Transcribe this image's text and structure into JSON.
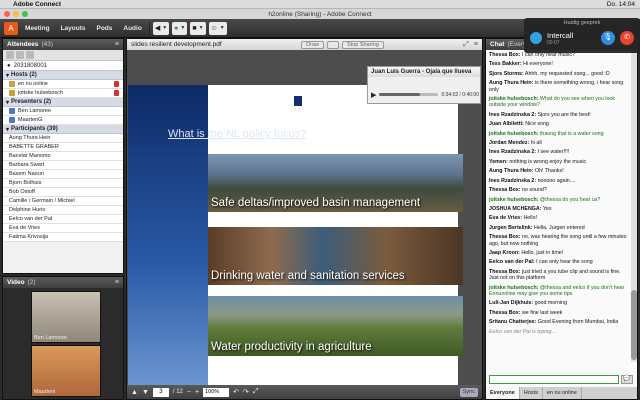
{
  "menubar": {
    "app_name": "Adobe Connect",
    "items": [
      "Meeting",
      "Layouts",
      "Pods",
      "Audio"
    ],
    "clock": "Do. 14:04"
  },
  "window": {
    "title": "h2online (Sharing) - Adobe Connect"
  },
  "toolbar": {
    "menus": [
      "Meeting",
      "Layouts",
      "Pods",
      "Audio"
    ]
  },
  "attendees": {
    "title": "Attendees",
    "count": "(43)",
    "self": "2031808001",
    "hosts": {
      "label": "Hosts (2)",
      "names": [
        "en nu online",
        "joitske hulsebosch"
      ]
    },
    "presenters": {
      "label": "Presenters (2)",
      "names": [
        "Ben Lamoree",
        "MaartenG"
      ]
    },
    "participants": {
      "label": "Participants (39)",
      "names": [
        "Aung Thura Hein",
        "BABETTE GRABER",
        "Bacelar Manomo",
        "Barbara Swart",
        "Basem Naouri",
        "Bjorn Bolhuis",
        "Bob Ostoff",
        "Camille / Germain / Michiel",
        "Delphine Hurio",
        "Eelco van der Pal",
        "Eva de Vries",
        "Fatima Krivosija"
      ]
    }
  },
  "video": {
    "title": "Video",
    "count": "(2)",
    "feeds": [
      {
        "label": "Ben Lamoree"
      },
      {
        "label": "Maarteni"
      }
    ]
  },
  "share": {
    "title": "slides resilient development.pdf",
    "buttons": [
      "Draw",
      "Stop Sharing"
    ],
    "slide_title": "What is the NL policy focus?",
    "banners": [
      "Safe deltas/improved basin management",
      "Drinking water and sanitation services",
      "Water productivity in agriculture"
    ],
    "audio": {
      "title": "Juan Luis Guerra - Ojala que llueva",
      "time": "0:34:02 / 0:40:00",
      "progress": 0.68
    },
    "page": "3",
    "page_total": "/ 12",
    "zoom": "100%",
    "sync": "Sync"
  },
  "chat": {
    "title": "Chat",
    "subtitle": "(Everyone)",
    "messages": [
      {
        "author": "Thessa Box:",
        "text": " I can only hear music?",
        "style": ""
      },
      {
        "author": "Tess Bakker:",
        "text": " Hi everyone!",
        "style": ""
      },
      {
        "author": "Sjors Storms:",
        "text": " Ahhh, my requested song... good :D",
        "style": ""
      },
      {
        "author": "Aung Thura Hein:",
        "text": " is there something wrong, i hear song only",
        "style": ""
      },
      {
        "author": "joitske hulsebosch:",
        "text": " What do you see when you look outside your window?",
        "style": "g"
      },
      {
        "author": "Ines Rzadzinska 2:",
        "text": " Sjors you are the best!",
        "style": ""
      },
      {
        "author": "Juan Albiletti:",
        "text": " Nice song",
        "style": ""
      },
      {
        "author": "joitske hulsebosch:",
        "text": " thaung that is a water song",
        "style": "g"
      },
      {
        "author": "Jordan Mendez:",
        "text": " hi all",
        "style": ""
      },
      {
        "author": "Ines Rzadzinska 2:",
        "text": " I see water!!!!",
        "style": ""
      },
      {
        "author": "Yemen:",
        "text": " nothing is wrong enjoy the music",
        "style": ""
      },
      {
        "author": "Aung Thura Hein:",
        "text": " Oh! Thanks!",
        "style": ""
      },
      {
        "author": "Ines Rzadzinska 2:",
        "text": " nooooo again....",
        "style": ""
      },
      {
        "author": "Thessa Box:",
        "text": " no sound?",
        "style": ""
      },
      {
        "author": "joitske hulsebosch:",
        "text": " @thessa do you hear us?",
        "style": "g"
      },
      {
        "author": "JOSHUA MCHENGA:",
        "text": " Yes",
        "style": ""
      },
      {
        "author": "Eva de Vries:",
        "text": " Hello!",
        "style": ""
      },
      {
        "author": "Jurgen Bertelink:",
        "text": " Hella, Jurgen entered",
        "style": ""
      },
      {
        "author": "Thessa Box:",
        "text": " no, was hearing the song until a few minutes ago, but now nothing",
        "style": ""
      },
      {
        "author": "Jaap Kroon:",
        "text": " Hello, just in time!",
        "style": ""
      },
      {
        "author": "Eelco van der Pal:",
        "text": " I can only hear the song",
        "style": ""
      },
      {
        "author": "Thessa Box:",
        "text": " just tried a you tube clip and sound is fine. Just not on this platform",
        "style": ""
      },
      {
        "author": "joitske hulsebosch:",
        "text": " @thessa and eelco if you don't hear Ennuonline may give you some tips",
        "style": "g"
      },
      {
        "author": "Luli-Jan Dijkhuis:",
        "text": " good morning",
        "style": ""
      },
      {
        "author": "Thessa Box:",
        "text": " we fine last week",
        "style": ""
      },
      {
        "author": "Sritanu Chatterjee:",
        "text": " Good Evening from Mumbai, India",
        "style": ""
      },
      {
        "author": "",
        "text": "Eelco van der Pal is typing...",
        "style": "t"
      }
    ],
    "tabs": [
      "Everyone",
      "Hosts",
      "en nu online"
    ]
  },
  "call": {
    "header": "Huidig gesprek",
    "name": "Intercall",
    "duration": "00:07"
  },
  "colors": {
    "accent": "#2f8ce0",
    "hangup": "#e8452e",
    "host_green": "#1d6f1d"
  }
}
